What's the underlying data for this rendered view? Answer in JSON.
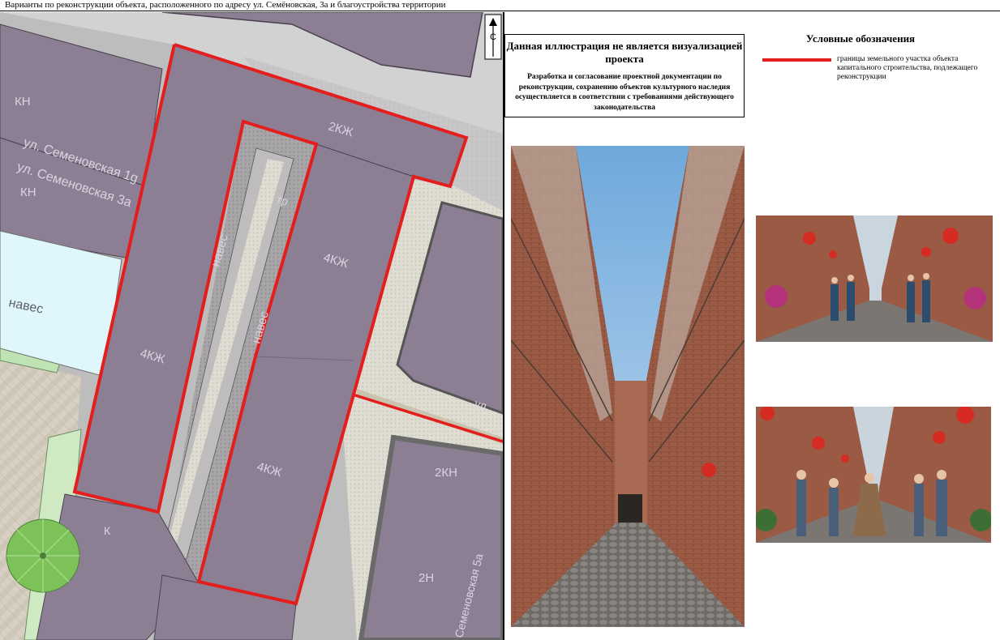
{
  "header": {
    "title": "Варианты по реконструкции объекта, расположенного по адресу ул. Семёновская, 3а и благоустройства территории"
  },
  "map": {
    "compass_letter": "С",
    "labels": {
      "kn_top": "КН",
      "kn_mid": "КН",
      "street_1g": "ул. Семеновская 1g",
      "street_3a": "ул. Семеновская 3а",
      "naves_left": "навес",
      "naves_strip_upper": "навес",
      "naves_strip_lower": "навес",
      "kzh2_top": "2КЖ",
      "kzh4_right": "4КЖ",
      "kzh4_left": "4КЖ",
      "kzh4_bottom": "4КЖ",
      "kn2": "2КН",
      "n2": "2Н",
      "k": "К",
      "street_right": "ул.",
      "street_5a": "Семеновская 5а",
      "tr": "тр"
    },
    "colors": {
      "building": "#8d7f93",
      "boundary": "#e41d1d",
      "canopy": "#dff7fb",
      "paving": "#d7d0c3",
      "tree": "#7cc258"
    }
  },
  "notice": {
    "title": "Данная иллюстрация не является визуализацией проекта",
    "body": "Разработка и согласование проектной документации по реконструкции, сохранению объектов культурного наследия осуществляется в соответствии с требованиями действующего законодательства"
  },
  "legend": {
    "title": "Условные обозначения",
    "items": [
      {
        "color": "#e41d1d",
        "label": "границы земельного участка объекта капитального строительства, подлежащего реконструкции"
      }
    ]
  }
}
